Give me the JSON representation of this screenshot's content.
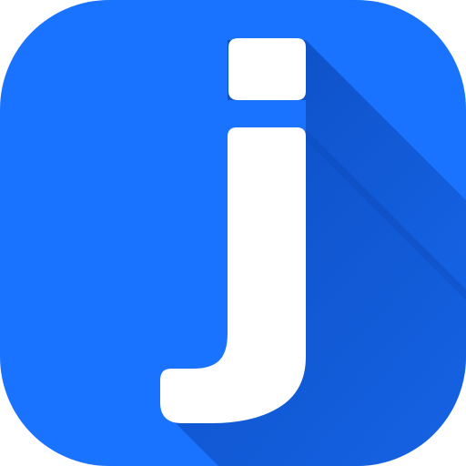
{
  "icon": {
    "name": "j-letter-app-icon",
    "letter": "j",
    "colors": {
      "background": "#1A73FF",
      "shadow": "#0E4FC4",
      "letter": "#FFFFFF"
    }
  }
}
